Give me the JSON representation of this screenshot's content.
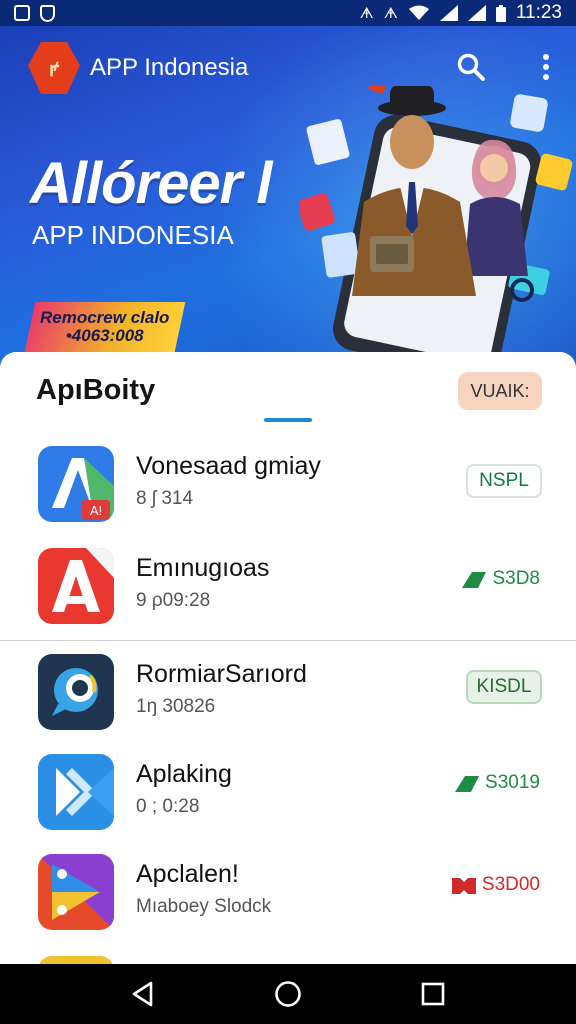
{
  "status_bar": {
    "time": "11:23",
    "left_icons": [
      "notification-box-icon",
      "shield-icon"
    ],
    "right_icons": [
      "nfc-icon",
      "vibrate-icon",
      "wifi-icon",
      "signal-icon",
      "signal-icon",
      "battery-icon"
    ]
  },
  "header": {
    "logo_text": "ꝵ",
    "app_name": "APP Indonesia",
    "actions": [
      "search-icon",
      "more-vert-icon"
    ]
  },
  "hero": {
    "title": "Allóreer l",
    "subtitle": "APP INDONESIA",
    "badge_line1": "Remocrew clalo",
    "badge_line2": "•4063:008",
    "colors": {
      "bg_start": "#1b3fb8",
      "bg_end": "#1b57c9"
    }
  },
  "section": {
    "title": "ApıBoity",
    "action_label": "VUAIK:"
  },
  "apps": [
    {
      "name": "Vonesaad gmiay",
      "meta": "8 ʃ 314",
      "action_type": "button-outline",
      "action_label": "NSPL"
    },
    {
      "name": "Emınugıoas",
      "meta": "9 ρ09:28",
      "action_type": "price",
      "action_label": "S3D8",
      "price_color": "#1e8c43"
    },
    {
      "name": "RormiarSarıord",
      "meta": "1ŋ 30826",
      "action_type": "button-filled",
      "action_label": "KISDL"
    },
    {
      "name": "Aplaking",
      "meta": "0 ; 0:28",
      "action_type": "price",
      "action_label": "S3019",
      "price_color": "#1e8c43"
    },
    {
      "name": "Apclalen!",
      "meta": "Mıaboey Slodck",
      "action_type": "price",
      "action_label": "S3D00",
      "price_color": "#d22a2a"
    }
  ],
  "nav": [
    "back-icon",
    "home-icon",
    "recents-icon"
  ]
}
